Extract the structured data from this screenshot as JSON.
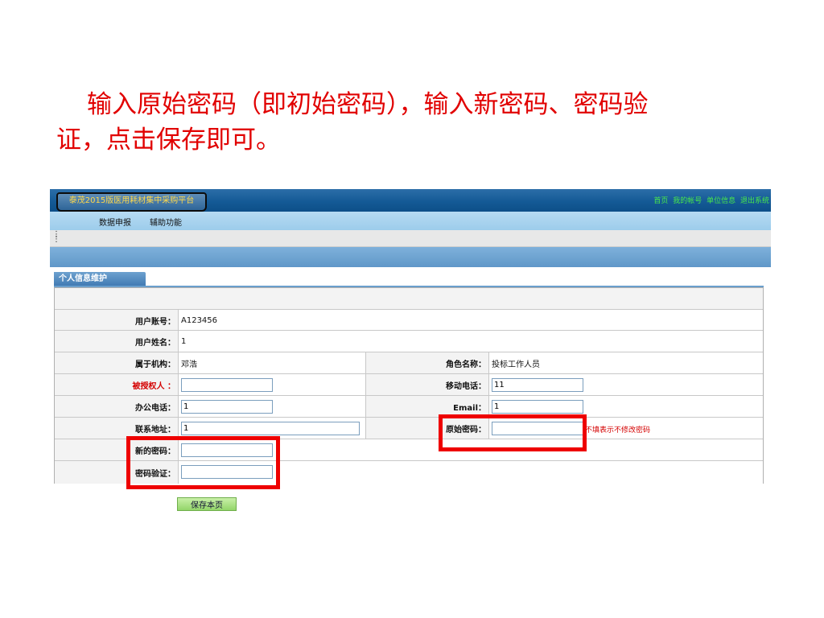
{
  "instruction": {
    "line1": "输入原始密码（即初始密码），输入新密码、密码验",
    "line2": "证，点击保存即可。"
  },
  "app": {
    "title": "泰茂2015版医用耗材集中采购平台",
    "top_links": [
      "首页",
      "我的帐号",
      "单位信息",
      "退出系统"
    ],
    "menu": [
      "数据申报",
      "辅助功能"
    ],
    "tab_label": "个人信息维护"
  },
  "form": {
    "account_label": "用户账号：",
    "account_value": "A123456",
    "name_label": "用户姓名：",
    "name_value": "1",
    "org_label": "属于机构：",
    "org_value": "邓浩",
    "role_label": "角色名称：",
    "role_value": "投标工作人员",
    "authorized_label": "被授权人 ：",
    "authorized_value": "",
    "mobile_label": "移动电话：",
    "mobile_value": "11",
    "office_phone_label": "办公电话：",
    "office_phone_value": "1",
    "email_label": "Email：",
    "email_value": "1",
    "address_label": "联系地址：",
    "address_value": "1",
    "orig_pwd_label": "原始密码：",
    "orig_pwd_value": "",
    "orig_pwd_hint": "不填表示不修改密码",
    "new_pwd_label": "新的密码：",
    "new_pwd_value": "",
    "confirm_pwd_label": "密码验证：",
    "confirm_pwd_value": "",
    "save_label": "保存本页"
  },
  "colors": {
    "instruction_text": "#e10000",
    "highlight_box": "#ee0000",
    "header_blue": "#145a96"
  }
}
